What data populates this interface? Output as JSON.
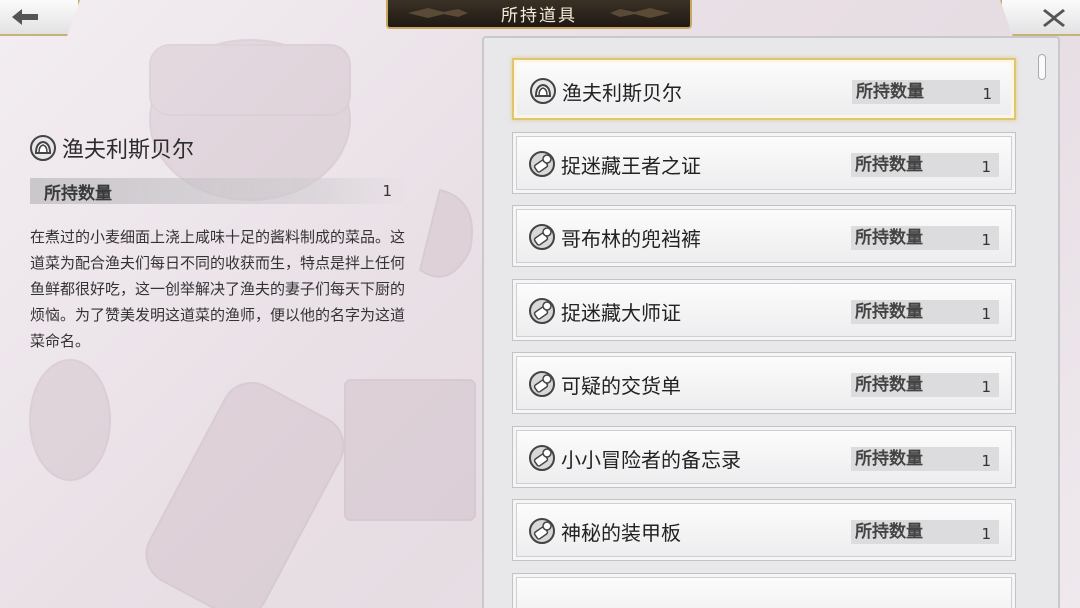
{
  "header": {
    "title": "所持道具",
    "back_icon": "arrow-left-icon",
    "close_icon": "close-x-icon"
  },
  "detail": {
    "name": "渔夫利斯贝尔",
    "icon": "food-bowl-icon",
    "qty_label": "所持数量",
    "qty_value": "1",
    "description": "在煮过的小麦细面上浇上咸味十足的酱料制成的菜品。这道菜为配合渔夫们每日不同的收获而生，特点是拌上任何鱼鲜都很好吃，这一创举解决了渔夫的妻子们每天下厨的烦恼。为了赞美发明这道菜的渔师，便以他的名字为这道菜命名。"
  },
  "list": {
    "qty_label": "所持数量",
    "items": [
      {
        "name": "渔夫利斯贝尔",
        "qty": "1",
        "icon": "food-bowl-icon",
        "selected": true
      },
      {
        "name": "捉迷藏王者之证",
        "qty": "1",
        "icon": "key-item-icon",
        "selected": false
      },
      {
        "name": "哥布林的兜裆裤",
        "qty": "1",
        "icon": "key-item-icon",
        "selected": false
      },
      {
        "name": "捉迷藏大师证",
        "qty": "1",
        "icon": "key-item-icon",
        "selected": false
      },
      {
        "name": "可疑的交货单",
        "qty": "1",
        "icon": "key-item-icon",
        "selected": false
      },
      {
        "name": "小小冒险者的备忘录",
        "qty": "1",
        "icon": "key-item-icon",
        "selected": false
      },
      {
        "name": "神秘的装甲板",
        "qty": "1",
        "icon": "key-item-icon",
        "selected": false
      }
    ]
  },
  "colors": {
    "accent_gold": "#e2c36f",
    "title_bg": "#2a221a",
    "panel_bg": "#e8e8ea"
  }
}
